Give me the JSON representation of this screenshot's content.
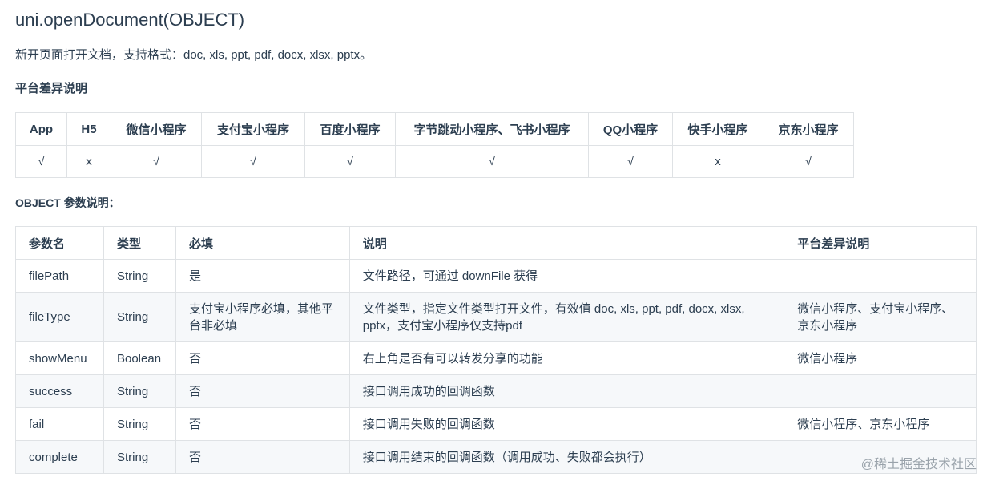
{
  "title": "uni.openDocument(OBJECT)",
  "description": "新开页面打开文档，支持格式：doc, xls, ppt, pdf, docx, xlsx, pptx。",
  "platform_heading": "平台差异说明",
  "platform_table": {
    "headers": [
      "App",
      "H5",
      "微信小程序",
      "支付宝小程序",
      "百度小程序",
      "字节跳动小程序、飞书小程序",
      "QQ小程序",
      "快手小程序",
      "京东小程序"
    ],
    "values": [
      "√",
      "x",
      "√",
      "√",
      "√",
      "√",
      "√",
      "x",
      "√"
    ]
  },
  "object_heading": "OBJECT 参数说明：",
  "params_table": {
    "headers": [
      "参数名",
      "类型",
      "必填",
      "说明",
      "平台差异说明"
    ],
    "rows": [
      [
        "filePath",
        "String",
        "是",
        "文件路径，可通过 downFile 获得",
        ""
      ],
      [
        "fileType",
        "String",
        "支付宝小程序必填，其他平台非必填",
        "文件类型，指定文件类型打开文件，有效值 doc, xls, ppt, pdf, docx, xlsx, pptx，支付宝小程序仅支持pdf",
        "微信小程序、支付宝小程序、京东小程序"
      ],
      [
        "showMenu",
        "Boolean",
        "否",
        "右上角是否有可以转发分享的功能",
        "微信小程序"
      ],
      [
        "success",
        "String",
        "否",
        "接口调用成功的回调函数",
        ""
      ],
      [
        "fail",
        "String",
        "否",
        "接口调用失败的回调函数",
        "微信小程序、京东小程序"
      ],
      [
        "complete",
        "String",
        "否",
        "接口调用结束的回调函数（调用成功、失败都会执行）",
        ""
      ]
    ]
  },
  "watermark": "@稀土掘金技术社区"
}
